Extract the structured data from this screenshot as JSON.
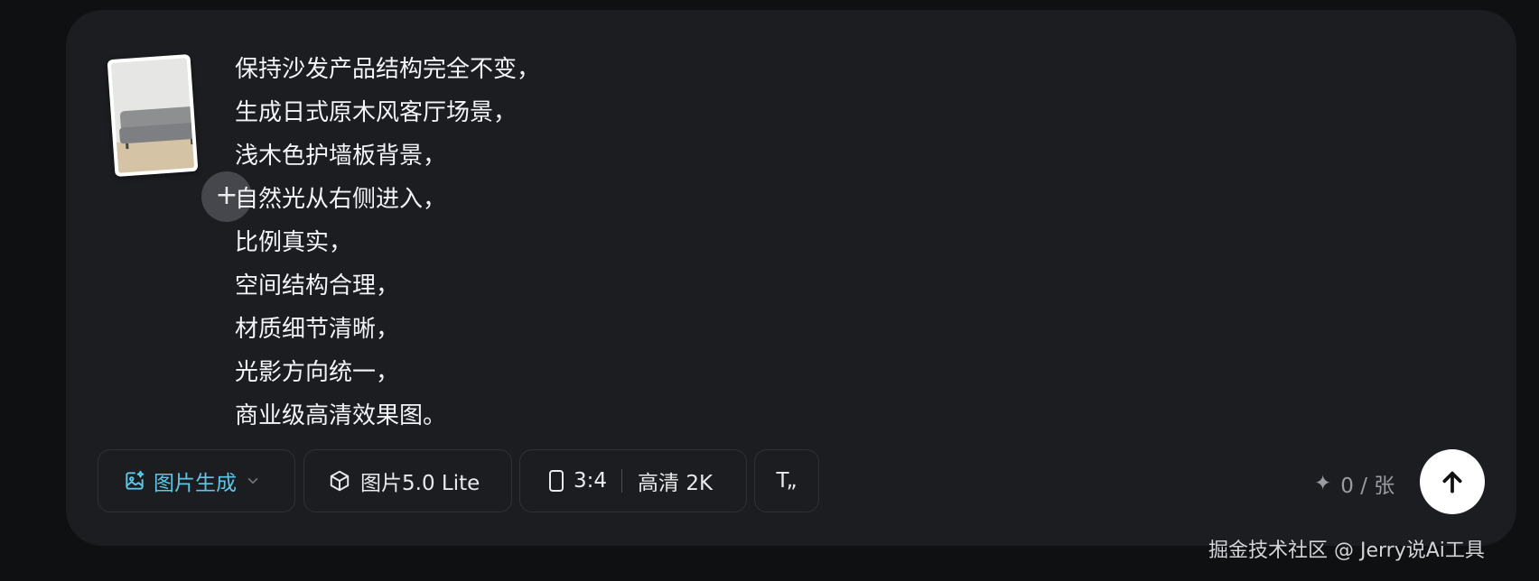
{
  "composer": {
    "prompt_lines": [
      "保持沙发产品结构完全不变，",
      "生成日式原木风客厅场景，",
      "浅木色护墙板背景，",
      "自然光从右侧进入，",
      "比例真实，",
      "空间结构合理，",
      "材质细节清晰，",
      "光影方向统一，",
      "商业级高清效果图。"
    ],
    "add_button_label": "+"
  },
  "toolbar": {
    "mode_label": "图片生成",
    "model_label": "图片5.0 Lite",
    "ratio_label": "3:4",
    "quality_label": "高清 2K",
    "text_tool_label": "T„",
    "credits_label": "0 / 张",
    "credits_icon": "✦"
  },
  "watermark": "掘金技术社区 @ Jerry说Ai工具",
  "colors": {
    "accent": "#5ec6e6",
    "card_bg": "#1c1d21",
    "page_bg": "#0f1012",
    "send_bg": "#ffffff"
  },
  "icons": [
    "image-generate-icon",
    "chevron-down-icon",
    "cube-icon",
    "aspect-ratio-icon",
    "text-style-icon",
    "sparkle-icon",
    "arrow-up-icon",
    "plus-icon"
  ]
}
